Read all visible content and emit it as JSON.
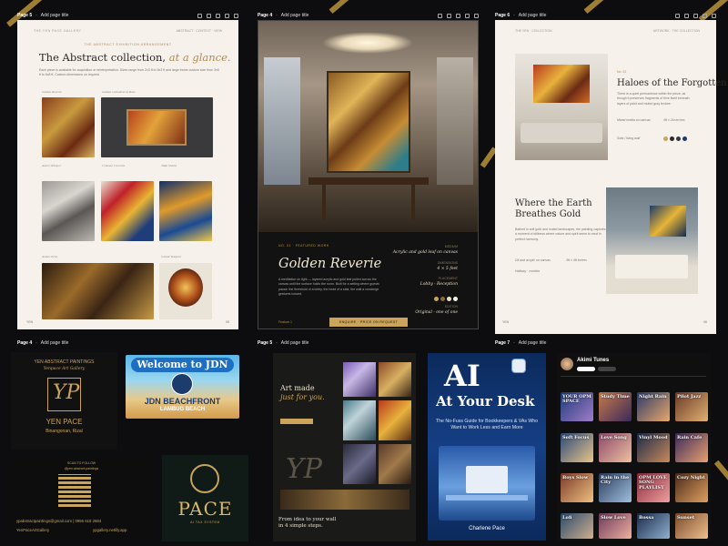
{
  "page5": {
    "name": "Page 5",
    "sub": "Add page title"
  },
  "page4": {
    "name": "Page 4",
    "sub": "Add page title"
  },
  "page6": {
    "name": "Page 6",
    "sub": "Add page title"
  },
  "page4b": {
    "name": "Page 4",
    "sub": "Add page title"
  },
  "page5b": {
    "name": "Page 5",
    "sub": "Add page title"
  },
  "page7": {
    "name": "Page 7",
    "sub": "Add page title"
  },
  "p5": {
    "eyebrow": "THE ABSTRACT EXHIBITION ARRANGEMENT",
    "title_a": "The Abstract collection,",
    "title_b": "at a glance.",
    "desc": "Each piece is available for acquisition or reinterpretation. Sizes range from 2x3 ft to 5x3 ft and large frame custom size from 3x5 ft to 6x8 ft. Custom dimensions on request.",
    "labels": [
      "Golden Reverie",
      "Golden Cathedral of Rose",
      "Ashen Whisper",
      "Crimson Currents",
      "Tidal Shield",
      "Amber Echo",
      "Cobalt Tempest",
      "Molten Threads",
      "Orbit of Ember"
    ]
  },
  "p4": {
    "eyebrow": "NO. 01 · FEATURED WORK",
    "title": "Golden Reverie",
    "desc": "A meditation on light — layered acrylic and gold leaf pulled across the canvas until the surface holds the room. Built for a setting where guests pause: the threshold of a lobby, the head of a stair, the wall a concierge gestures toward.",
    "medium_label": "MEDIUM",
    "medium": "Acrylic and gold leaf on canvas",
    "size_label": "DIMENSIONS",
    "size": "4 × 5 feet",
    "placement_label": "PLACEMENT",
    "placement": "Lobby · Reception",
    "edition_label": "EDITION",
    "edition": "Original · one of one",
    "button": "ENQUIRE · PRICE ON REQUEST",
    "footer_left": "Feature 1"
  },
  "p6": {
    "num1": "No. 02",
    "title1": "Haloes of the Forgotten",
    "desc1": "There is a quiet permanence within the piece, as though it preserves fragments of time itself beneath layers of paint and muted gray texture.",
    "medium1": "Mixed media on canvas",
    "size1": "4ft × 2in inches",
    "room1": "Sofa / living wall",
    "title2": "Where the Earth Breathes Gold",
    "desc2": "Bathed in soft gold and muted landscapes, the painting captures a moment of stillness where nature and spirit seem to exist in perfect harmony.",
    "medium2": "Oil and acrylic on canvas",
    "size2": "3ft × 4ft inches",
    "room2": "Hallway · corridor"
  },
  "card1": {
    "line1": "YEN ABSTRACT PAINTINGS",
    "line2": "Yenpace Art Gallery",
    "line3": "YEN PACE",
    "line4": "Binangonan, Rizal"
  },
  "card2": {
    "title": "Welcome to JDN",
    "sub": "JDN BEACHFRONT",
    "sub2": "LAMBUG BEACH"
  },
  "card3": {
    "title": "SCAN TO FOLLOW",
    "handle": "@yen.abstract.paintings",
    "email": "ypabstractpaintings@gmail.com | 0956 618 2684",
    "fb": "YenPaceArtGallery",
    "site": "ypgallery.netlify.app"
  },
  "card4": {
    "name": "PACE",
    "tag": "AI TAX SYSTEM"
  },
  "card5": {
    "title": "Art made",
    "title2": "just for you.",
    "footer": "From idea to your wall in 4 simple steps."
  },
  "card6": {
    "title": "AI",
    "title2": "At Your Desk",
    "desc": "The No-Fuss Guide for Bookkeepers & VAs Who Want to Work Less and Earn More",
    "author": "Charlene Pace"
  },
  "card7": {
    "channel": "Akimi Tunes",
    "thumbs": [
      "YOUR OPM SPACE",
      "Study Time",
      "Night Rain",
      "Pilot Jazz",
      "Soft Focus",
      "Love Song",
      "Vinyl Mood",
      "Rain Cafe",
      "Boys Slow",
      "Rain in the City",
      "OPM LOVE SONG PLAYLIST",
      "Cozy Night",
      "Lofi",
      "Slow Love",
      "Bossa",
      "Sunset"
    ]
  },
  "colors": {
    "bg": "#0d0d0f",
    "gold": "#b8933a",
    "cream": "#f6f1ea"
  }
}
